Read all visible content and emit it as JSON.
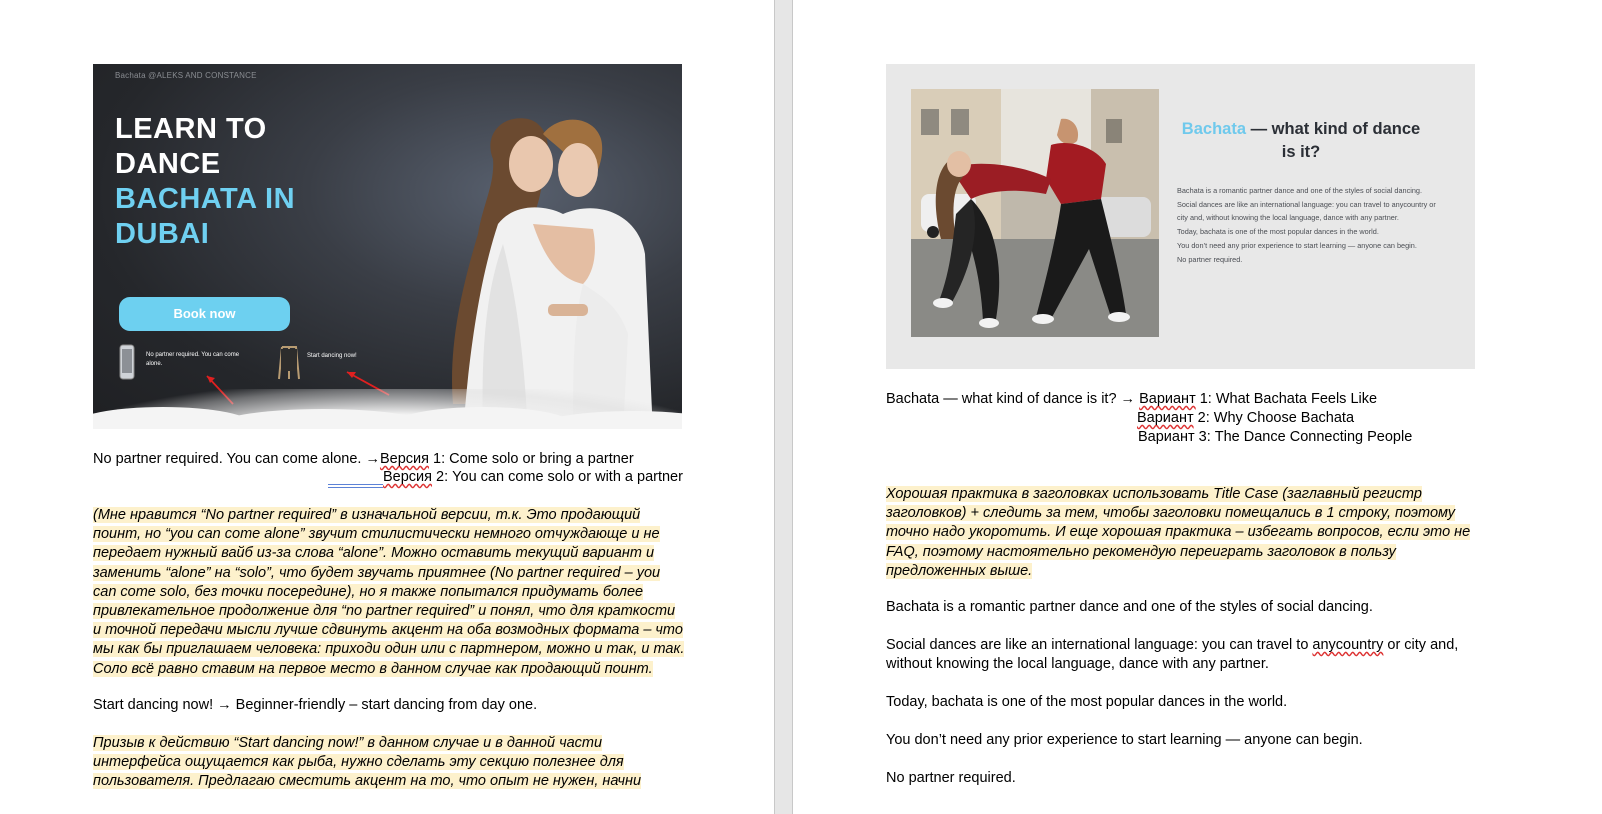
{
  "left_page": {
    "hero": {
      "brand": "Bachata @ALEKS AND CONSTANCE",
      "title_lines_white": [
        "LEARN TO",
        "DANCE"
      ],
      "title_lines_blue": [
        "BACHATA IN",
        "DUBAI"
      ],
      "button": "Book now",
      "feature1": "No partner required. You can come alone.",
      "feature2": "Start dancing now!"
    },
    "line1": {
      "original": "No partner required. You can come alone.",
      "arrow": "→",
      "v1_word": "Версия",
      "v1_rest": " 1: Come solo or bring a partner",
      "v2_word": "Версия",
      "v2_rest": " 2: You can come solo or with a partner"
    },
    "comment1": [
      "(Мне нравится “No partner required” в изначальной версии, т.к. Это продающий",
      "поинт, но “you can come alone” звучит стилистически немного отчуждающе и не",
      "передает нужный вайб из-за слова “alone”. Можно оставить текущий вариант и",
      "заменить “alone” на “solo”, что будет звучать приятнее (No partner required – you",
      "can come solo, без точки посередине), но я также попытался придумать более",
      "привлекательное продолжение для “no partner required” и понял, что для краткости",
      "и точной передачи мысли лучше сдвинуть акцент на оба возмодных формата – что",
      "мы как бы приглашаем человека: приходи один или с партнером, можно и так, и так.",
      "Соло всё равно ставим на первое место в данном случае как продающий поинт."
    ],
    "line2": "Start dancing now! → Beginner-friendly – start dancing from day one.",
    "comment2": [
      "Призыв к действию “Start dancing now!” в данном случае и в данной части",
      "интерфейса ощущается как рыба, нужно сделать эту секцию полезнее для",
      "пользователя. Предлагаю сместить акцент на то, что опыт не нужен, начни"
    ]
  },
  "right_page": {
    "card": {
      "title_accent": "Bachata",
      "title_rest": " — what kind of dance is it?",
      "body": [
        "Bachata is a romantic partner dance and one of the styles of social dancing.",
        "Social dances are like an international language: you can travel to anycountry or city and, without knowing the local language, dance with any partner.",
        "Today, bachata is one of the most popular dances in the world.",
        "You don’t need any prior experience to start learning — anyone can begin.",
        "No partner required."
      ]
    },
    "heading_line": {
      "original": "Bachata — what kind of dance is it? →",
      "word": "Вариант",
      "v1": " 1: What Bachata Feels Like",
      "v2": " 2: Why Choose Bachata",
      "v3": "Вариант 3: The Dance Connecting People"
    },
    "comment": [
      "Хорошая практика в заголовках использовать Title Case (заглавный регистр",
      "заголовков) + следить за тем, чтобы заголовки помещались в 1 строку, поэтому",
      "точно надо укоротить. И еще хорошая практика – избегать вопросов, если это не",
      "FAQ, поэтому настоятельно рекомендую переиграть заголовок в пользу",
      "предложенных выше."
    ],
    "p1": "Bachata is a romantic partner dance and one of the styles of social dancing.",
    "p2_a": "Social dances are like an international language: you can travel to ",
    "p2_sq": "anycountry",
    "p2_b": " or city and,",
    "p2_c": "without knowing the local language, dance with any partner.",
    "p3": "Today, bachata is one of the most popular dances in the world.",
    "p4": "You don’t need any prior experience to start learning — anyone can begin.",
    "p5": "No partner required."
  },
  "colors": {
    "accent_blue": "#6fd0f1",
    "highlight": "#fdf1cc",
    "arrow_red": "#e02020"
  }
}
